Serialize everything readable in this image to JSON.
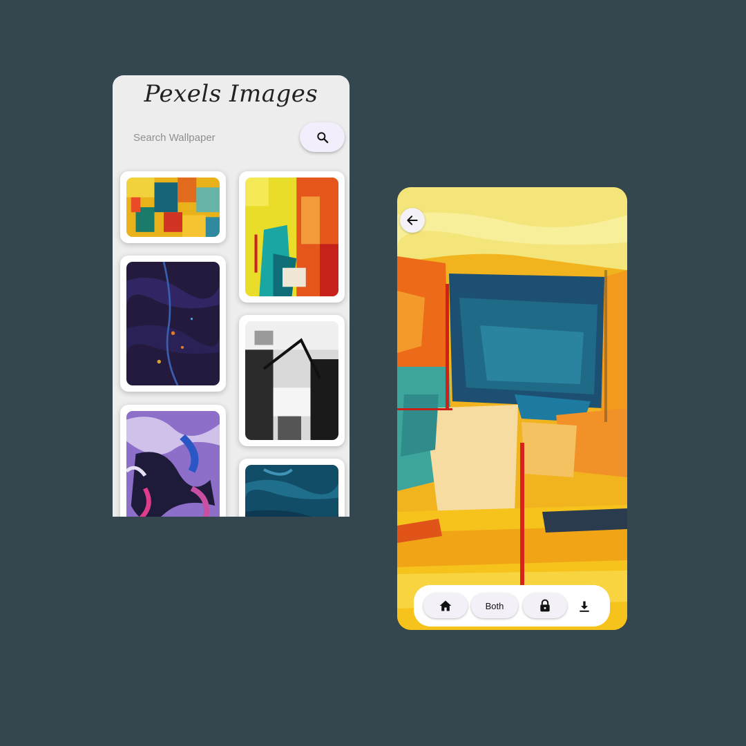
{
  "gallery": {
    "title": "Pexels Images",
    "search": {
      "placeholder": "Search Wallpaper",
      "value": ""
    },
    "search_button_icon": "search-icon",
    "wallpapers": [
      {
        "name": "abstract-yellow-teal",
        "column": 1
      },
      {
        "name": "dark-purple-marble",
        "column": 1
      },
      {
        "name": "purple-pink-swirl",
        "column": 1
      },
      {
        "name": "yellow-orange-teal",
        "column": 2
      },
      {
        "name": "black-white-abstract",
        "column": 2
      },
      {
        "name": "blue-ocean-paint",
        "column": 2
      }
    ]
  },
  "preview": {
    "back_icon": "arrow-left-icon",
    "actions": [
      {
        "icon": "home-icon",
        "label": ""
      },
      {
        "icon": "",
        "label": "Both"
      },
      {
        "icon": "lock-icon",
        "label": ""
      },
      {
        "icon": "download-icon",
        "label": ""
      }
    ]
  },
  "colors": {
    "background": "#34474f",
    "gallery_bg": "#ededed",
    "button_bg": "#f3eefb",
    "card_bg": "#ffffff"
  }
}
